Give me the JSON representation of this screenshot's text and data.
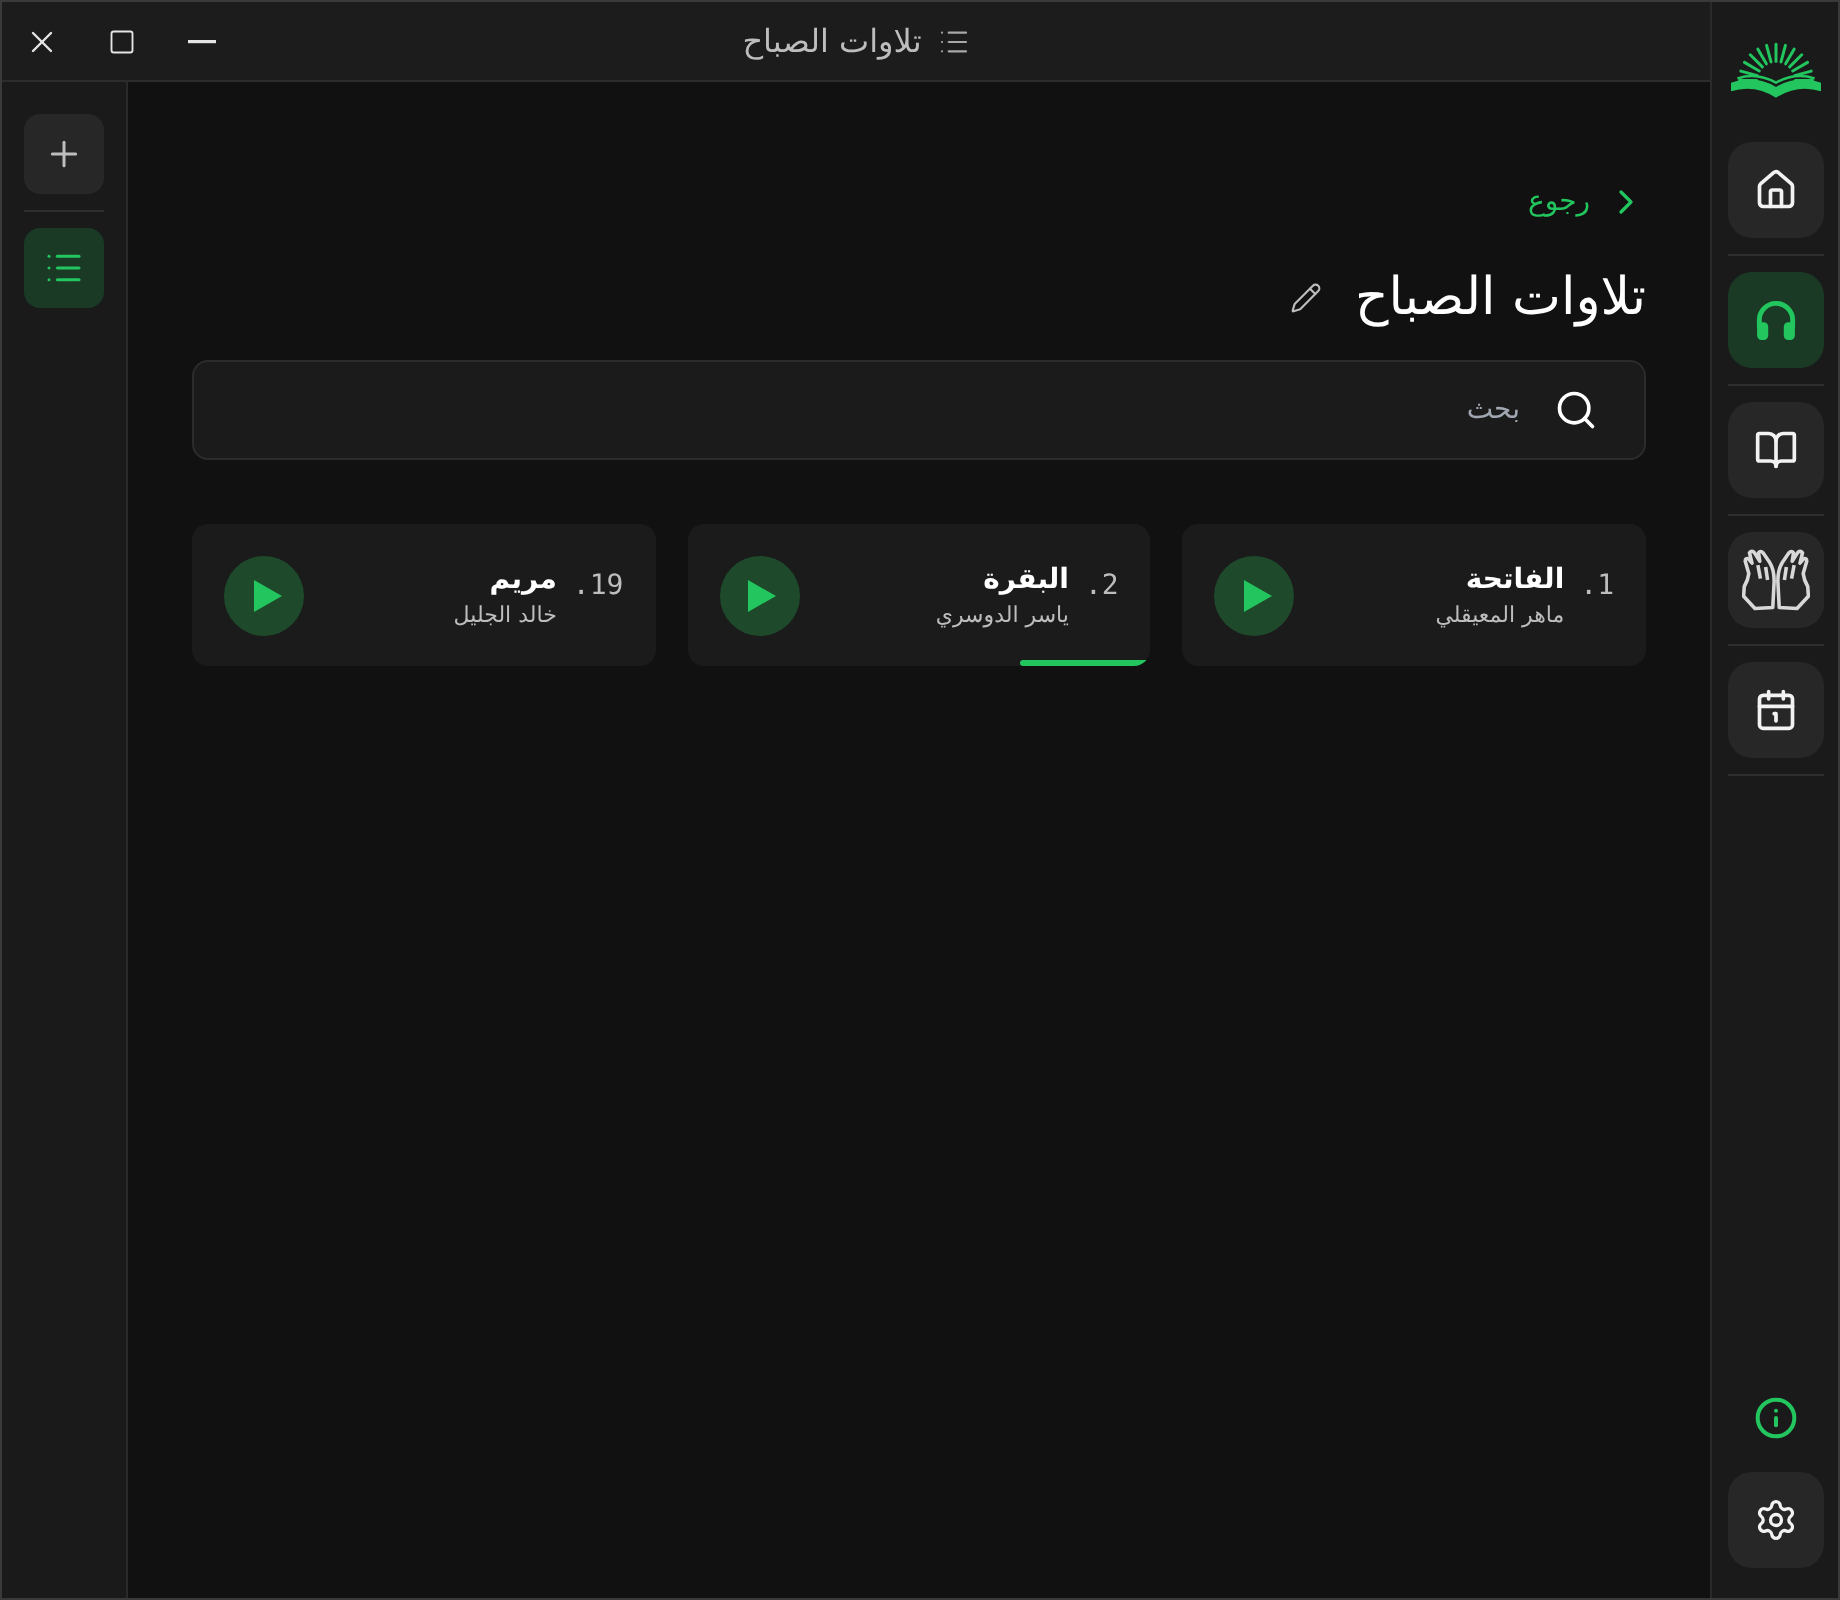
{
  "window": {
    "title": "تلاوات الصباح"
  },
  "left_toolbar": [
    {
      "selected": false
    },
    {
      "selected": true
    }
  ],
  "nav": {
    "items": [
      {
        "selected": false
      },
      {
        "selected": true
      },
      {
        "selected": false
      },
      {
        "selected": false
      },
      {
        "selected": false
      }
    ]
  },
  "page": {
    "back": "رجوع",
    "title": "تلاوات الصباح",
    "search": {
      "placeholder": "بحث"
    },
    "tracks": [
      {
        "number": "1.",
        "title": "الفاتحة",
        "reciter": "ماهر المعيقلي"
      },
      {
        "number": "2.",
        "title": "البقرة",
        "reciter": "ياسر الدوسري",
        "level": 0.28
      },
      {
        "number": "19.",
        "title": "مريم",
        "reciter": "خالد الجليل"
      }
    ]
  }
}
